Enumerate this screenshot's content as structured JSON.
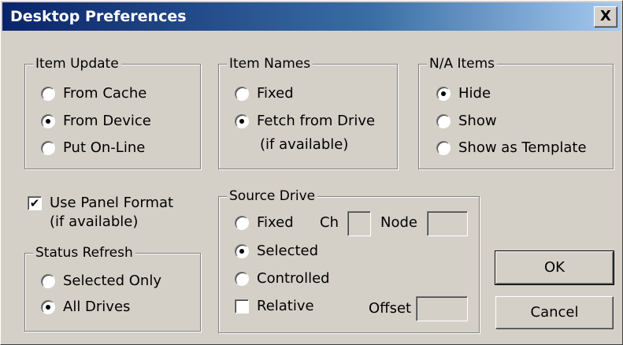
{
  "window": {
    "title": "Desktop Preferences",
    "close_glyph": "X"
  },
  "item_update": {
    "legend": "Item Update",
    "options": [
      "From Cache",
      "From Device",
      "Put On-Line"
    ],
    "selected": "From Device"
  },
  "item_names": {
    "legend": "Item Names",
    "options": [
      "Fixed",
      "Fetch from Drive"
    ],
    "fetch_sub": "(if available)",
    "selected": "Fetch from Drive"
  },
  "na_items": {
    "legend": "N/A Items",
    "options": [
      "Hide",
      "Show",
      "Show as Template"
    ],
    "selected": "Hide"
  },
  "panel_format": {
    "label": "Use Panel Format",
    "sub": "(if available)",
    "checked": true,
    "check_glyph": "✔"
  },
  "status_refresh": {
    "legend": "Status Refresh",
    "options": [
      "Selected Only",
      "All Drives"
    ],
    "selected": "All Drives"
  },
  "source_drive": {
    "legend": "Source Drive",
    "options": [
      "Fixed",
      "Selected",
      "Controlled"
    ],
    "selected": "Selected",
    "ch_label": "Ch",
    "ch_value": "",
    "node_label": "Node",
    "node_value": "",
    "relative_label": "Relative",
    "relative_checked": false,
    "offset_label": "Offset",
    "offset_value": ""
  },
  "buttons": {
    "ok": "OK",
    "cancel": "Cancel"
  }
}
